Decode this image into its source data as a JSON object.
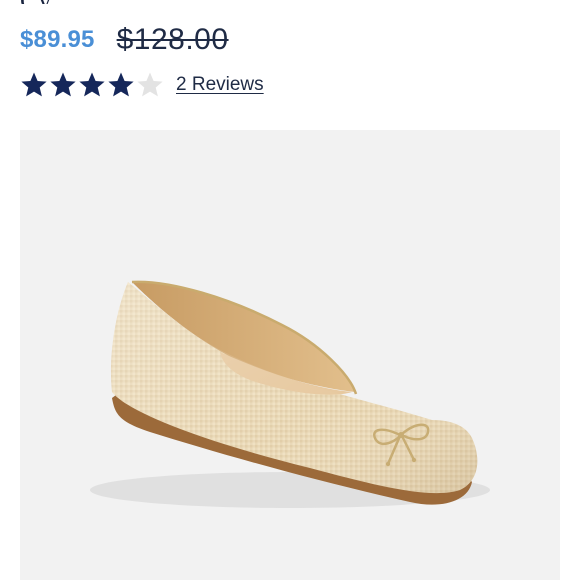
{
  "product": {
    "title_fragment": "Cy",
    "sale_price": "$89.95",
    "original_price": "$128.00",
    "rating": 4,
    "rating_max": 5,
    "reviews_label": "2 Reviews"
  },
  "colors": {
    "sale_price": "#4a8fd6",
    "star_filled": "#15275a",
    "star_empty": "#e3e3e3",
    "text_dark": "#1f2b45",
    "image_bg": "#f2f2f2"
  },
  "image": {
    "subject": "natural woven ballet flat with gold bow"
  }
}
